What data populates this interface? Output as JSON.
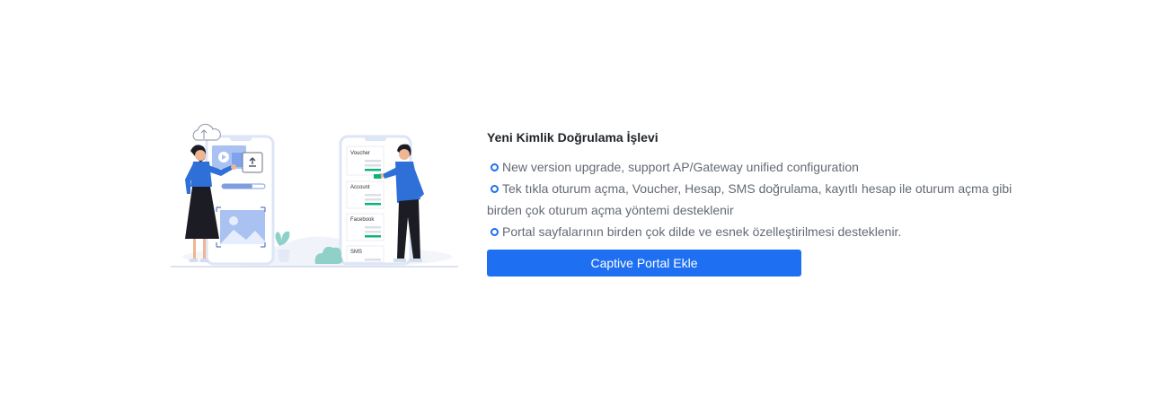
{
  "illustration": {
    "phone_cards": [
      "Voucher",
      "Account",
      "Facebook",
      "SMS"
    ]
  },
  "feature": {
    "title": "Yeni Kimlik Doğrulama İşlevi",
    "items": [
      "New version upgrade, support AP/Gateway unified configuration",
      "Tek tıkla oturum açma, Voucher, Hesap, SMS doğrulama, kayıtlı hesap ile oturum açma gibi",
      "birden çok oturum açma yöntemi desteklenir",
      "Portal sayfalarının birden çok dilde ve esnek özelleştirilmesi desteklenir."
    ],
    "button_label": "Captive Portal Ekle"
  },
  "colors": {
    "accent": "#1e6ff1",
    "title_text": "#1f2329",
    "body_text": "#646a73"
  }
}
